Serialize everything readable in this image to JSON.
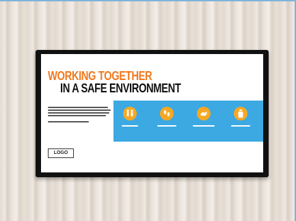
{
  "signage": {
    "headline_line1": "WORKING TOGETHER",
    "headline_line2": "IN A SAFE ENVIRONMENT",
    "logo_label": "LOGO"
  },
  "icons": [
    {
      "name": "distancing-people-icon"
    },
    {
      "name": "footprints-icon"
    },
    {
      "name": "handwashing-icon"
    },
    {
      "name": "sanitizer-icon"
    }
  ],
  "colors": {
    "accent_orange": "#f07a20",
    "panel_blue": "#3ca9e2",
    "icon_orange": "#f7a823"
  }
}
